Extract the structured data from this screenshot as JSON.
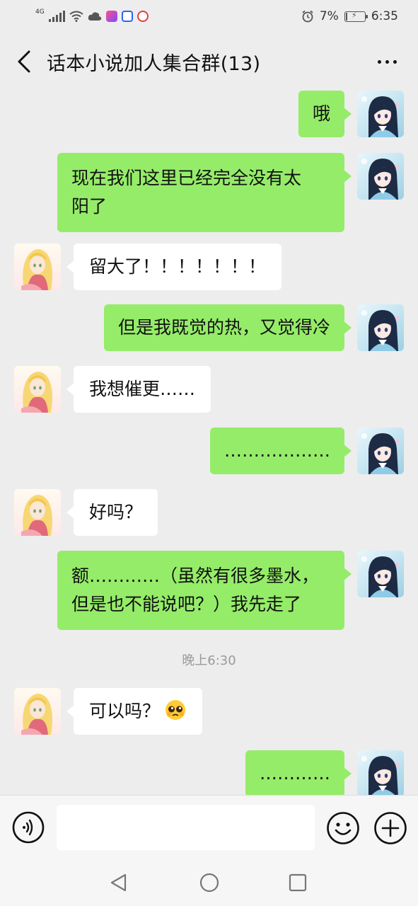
{
  "status_bar": {
    "network": "4G",
    "alarm_icon": "alarm-clock-icon",
    "battery_percent": "7%",
    "battery_level": 0.07,
    "time": "6:35"
  },
  "header": {
    "back_icon": "chevron-left-icon",
    "title": "话本小说加人集合群(13)",
    "more_icon": "more-dots-icon"
  },
  "messages": [
    {
      "sender": "self",
      "text": "哦"
    },
    {
      "sender": "self",
      "lines": [
        "现在我们这里已经完全没有太",
        "阳了"
      ]
    },
    {
      "sender": "other",
      "text": "留大了！！！！！！！"
    },
    {
      "sender": "self",
      "text": "但是我既觉的热，又觉得冷"
    },
    {
      "sender": "other",
      "text": "我想催更……"
    },
    {
      "sender": "self",
      "text": "………………"
    },
    {
      "sender": "other",
      "text": "好吗？"
    },
    {
      "sender": "self",
      "lines": [
        "额…………（虽然有很多墨水，",
        "但是也不能说吧？）我先走了"
      ]
    },
    {
      "sender": "other",
      "text": "可以吗？",
      "emoji": "pleading-face-emoji"
    },
    {
      "sender": "self",
      "text": "…………"
    }
  ],
  "timestamp": "晚上6:30",
  "input_bar": {
    "voice_icon": "voice-input-icon",
    "input_value": "",
    "emoji_icon": "smiley-face-icon",
    "add_icon": "plus-circle-icon"
  },
  "system_nav": [
    "back-triangle-icon",
    "home-circle-icon",
    "recents-square-icon"
  ],
  "colors": {
    "background": "#ededed",
    "self_bubble": "#95ec69",
    "other_bubble": "#ffffff",
    "timestamp_text": "#9a9a9a"
  }
}
